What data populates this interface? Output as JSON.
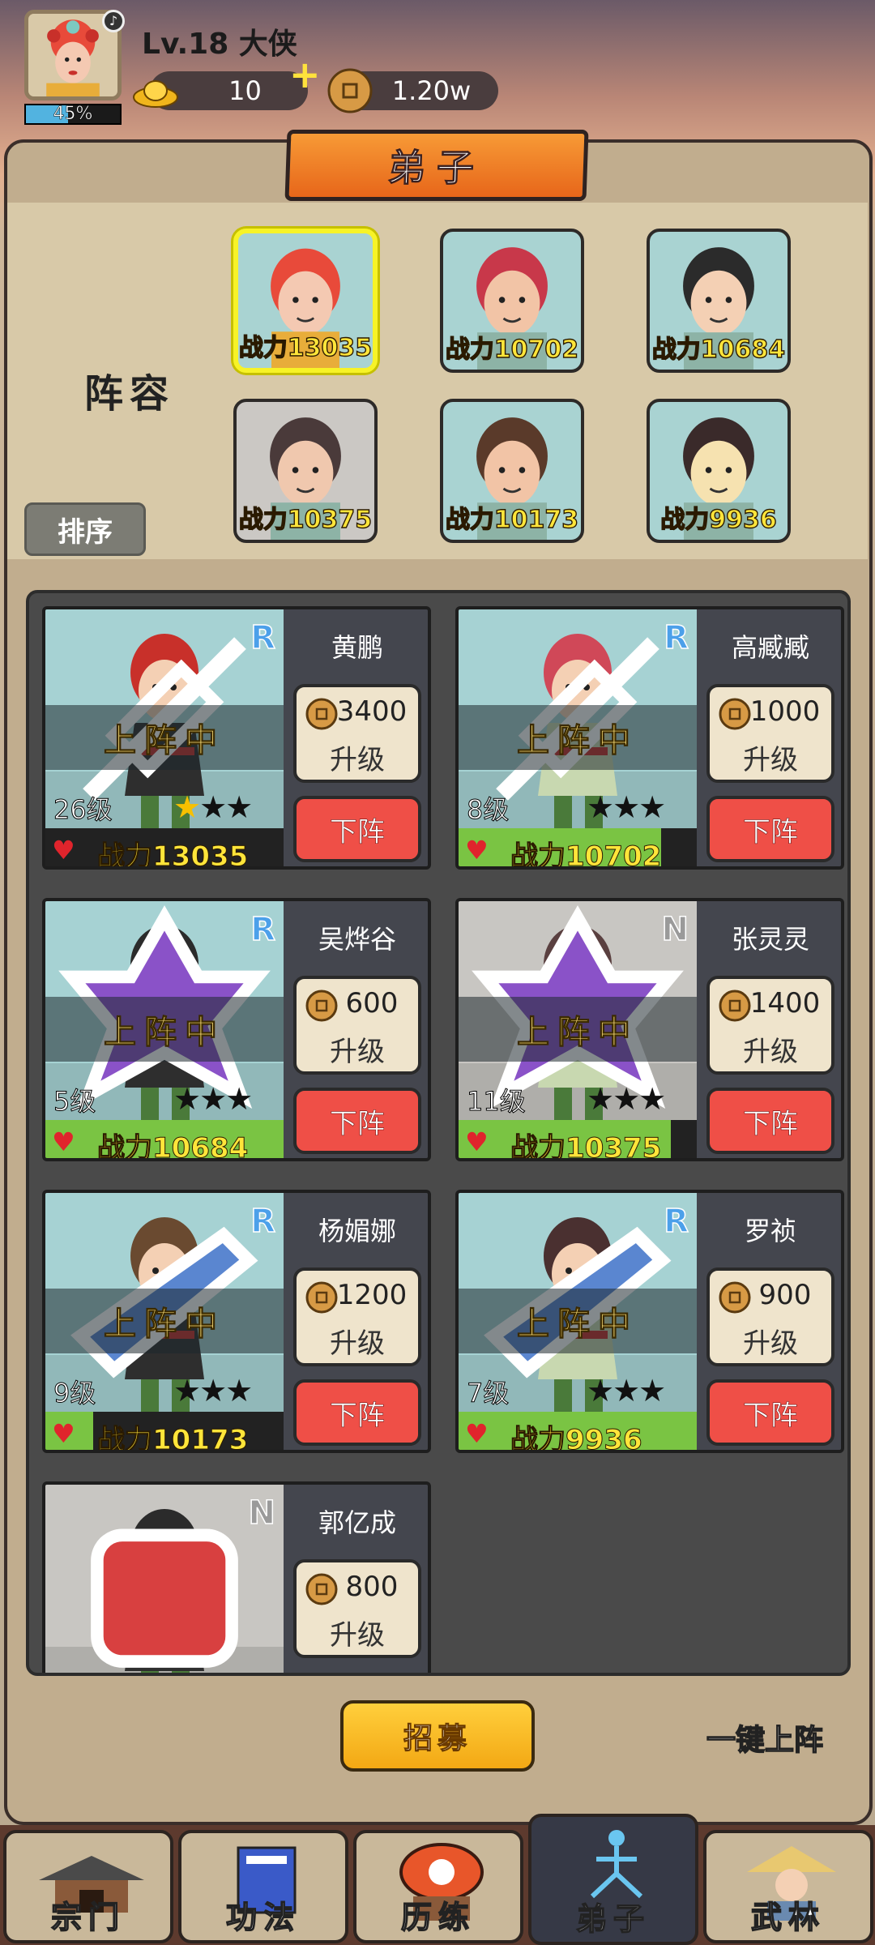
{
  "player": {
    "level_title": "Lv.18 大侠",
    "exp_percent": 45,
    "exp_label": "45%",
    "gold": "10",
    "coins": "1.20w",
    "plus": "+"
  },
  "panel": {
    "title": "弟子",
    "lineup_label": "阵容",
    "sort_label": "排序"
  },
  "lineup": [
    {
      "power": "战力13035",
      "hero": "黄鹏",
      "bg": "teal",
      "selected": true
    },
    {
      "power": "战力10702",
      "hero": "高臧臧",
      "bg": "teal",
      "selected": false
    },
    {
      "power": "战力10684",
      "hero": "吴烨谷",
      "bg": "teal",
      "selected": false
    },
    {
      "power": "战力10375",
      "hero": "张灵灵",
      "bg": "grey",
      "selected": false
    },
    {
      "power": "战力10173",
      "hero": "杨媚娜",
      "bg": "teal",
      "selected": false
    },
    {
      "power": "战力9936",
      "hero": "罗祯",
      "bg": "teal",
      "selected": false
    }
  ],
  "cards": [
    {
      "name": "黄鹏",
      "rarity": "R",
      "status": "上阵中",
      "level": "26级",
      "stars_gold": 1,
      "stars_total": 3,
      "power": "战力13035",
      "power_fill": 0,
      "cost": "3400",
      "upgrade": "升级",
      "remove": "下阵",
      "class": "spear-icon",
      "grey": false
    },
    {
      "name": "高臧臧",
      "rarity": "R",
      "status": "上阵中",
      "level": "8级",
      "stars_gold": 0,
      "stars_total": 3,
      "power": "战力10702",
      "power_fill": 0.85,
      "cost": "1000",
      "upgrade": "升级",
      "remove": "下阵",
      "class": "spear-icon",
      "grey": false
    },
    {
      "name": "吴烨谷",
      "rarity": "R",
      "status": "上阵中",
      "level": "5级",
      "stars_gold": 0,
      "stars_total": 3,
      "power": "战力10684",
      "power_fill": 1.0,
      "cost": "600",
      "upgrade": "升级",
      "remove": "下阵",
      "class": "magic-icon",
      "grey": false
    },
    {
      "name": "张灵灵",
      "rarity": "N",
      "status": "上阵中",
      "level": "11级",
      "stars_gold": 0,
      "stars_total": 3,
      "power": "战力10375",
      "power_fill": 0.89,
      "cost": "1400",
      "upgrade": "升级",
      "remove": "下阵",
      "class": "magic-icon",
      "grey": true
    },
    {
      "name": "杨媚娜",
      "rarity": "R",
      "status": "上阵中",
      "level": "9级",
      "stars_gold": 0,
      "stars_total": 3,
      "power": "战力10173",
      "power_fill": 0.2,
      "cost": "1200",
      "upgrade": "升级",
      "remove": "下阵",
      "class": "blade-icon",
      "grey": false
    },
    {
      "name": "罗祯",
      "rarity": "R",
      "status": "上阵中",
      "level": "7级",
      "stars_gold": 0,
      "stars_total": 3,
      "power": "战力9936",
      "power_fill": 1.0,
      "cost": "900",
      "upgrade": "升级",
      "remove": "下阵",
      "class": "blade-icon",
      "grey": false
    },
    {
      "name": "郭亿成",
      "rarity": "N",
      "status": "",
      "level": "",
      "stars_gold": 0,
      "stars_total": 0,
      "power": "",
      "power_fill": 0,
      "cost": "800",
      "upgrade": "升级",
      "remove": "",
      "class": "fist-icon",
      "grey": true
    }
  ],
  "actions": {
    "recruit": "招募",
    "auto_deploy": "一键上阵"
  },
  "nav": [
    {
      "label": "宗门",
      "icon": "temple-icon",
      "active": false
    },
    {
      "label": "功法",
      "icon": "book-icon",
      "active": false
    },
    {
      "label": "历练",
      "icon": "drum-icon",
      "active": false
    },
    {
      "label": "弟子",
      "icon": "meditation-icon",
      "active": true
    },
    {
      "label": "武林",
      "icon": "straw-hat-icon",
      "active": false
    }
  ],
  "colors": {
    "accent_orange": "#e7661a",
    "power_yellow": "#ffe53a",
    "power_green": "#7ac443",
    "remove_red": "#ef4f47",
    "rarity_blue": "#4ca0ea"
  }
}
